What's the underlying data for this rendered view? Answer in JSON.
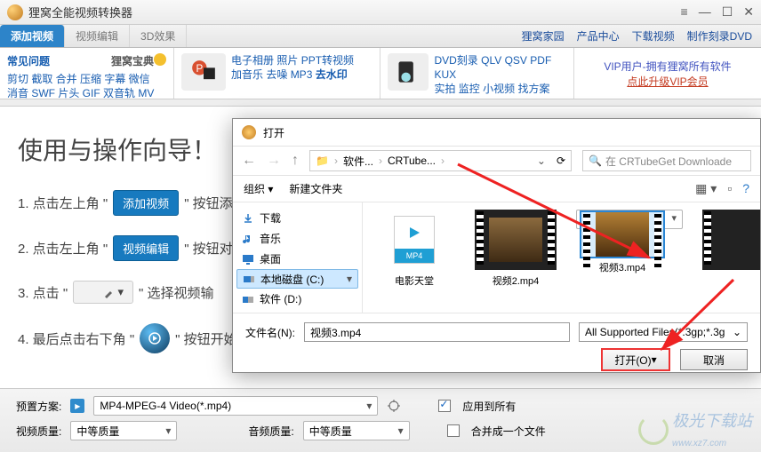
{
  "window": {
    "title": "狸窝全能视频转换器"
  },
  "tabs": {
    "add": "添加视频",
    "edit": "视频编辑",
    "fx": "3D效果"
  },
  "topLinks": {
    "l1": "狸窝家园",
    "l2": "产品中心",
    "l3": "下载视频",
    "l4": "制作刻录DVD"
  },
  "cell1": {
    "hd": "常见问题",
    "baodian": "狸窝宝典",
    "l1": "剪切 截取 合并 压缩 字幕 微信",
    "l2": "消音 SWF 片头 GIF 双音轨 MV"
  },
  "cell2": {
    "l1a": "电子相册 ",
    "l1b": "照片 ",
    "l1c": "PPT转视频",
    "l2a": "加音乐 ",
    "l2b": "去噪 ",
    "l2c": "MP3 ",
    "l2d": "去水印"
  },
  "cell3": {
    "l1": "DVD刻录 QLV QSV PDF KUX",
    "l2": "实拍 监控 小视频 找方案"
  },
  "cell4": {
    "l1": "VIP用户-拥有狸窝所有软件",
    "l2": "点此升级VIP会员"
  },
  "wizard": {
    "title": "使用与操作向导！",
    "s1a": "1. 点击左上角 \"",
    "s1btn": "添加视频",
    "s1b": "\" 按钮添加",
    "s2a": "2. 点击左上角 \"",
    "s2btn": "视频编辑",
    "s2b": "\" 按钮对视",
    "s3a": "3. 点击 \"",
    "s3b": "\" 选择视频输",
    "s4a": "4. 最后点击右下角 \"",
    "s4b": "\" 按钮开始"
  },
  "bottom": {
    "preset_lbl": "预置方案:",
    "preset_val": "MP4-MPEG-4 Video(*.mp4)",
    "apply_all": "应用到所有",
    "vq_lbl": "视频质量:",
    "vq_val": "中等质量",
    "aq_lbl": "音频质量:",
    "aq_val": "中等质量",
    "merge": "合并成一个文件",
    "wm": "极光下载站",
    "wm_url": "www.xz7.com"
  },
  "dlg": {
    "title": "打开",
    "crumb1": "软件...",
    "crumb2": "CRTube...",
    "search_ph": "在 CRTubeGet Downloade",
    "org": "组织",
    "newf": "新建文件夹",
    "tree": {
      "dl": "下载",
      "music": "音乐",
      "desktop": "桌面",
      "cdrive": "本地磁盘 (C:)",
      "ddrive": "软件 (D:)"
    },
    "files": {
      "f1": "电影天堂",
      "f2": "视频2.mp4",
      "f3": "视频3.mp4",
      "mp4": "MP4"
    },
    "fn_lbl": "文件名(N):",
    "fn_val": "视频3.mp4",
    "filter": "All Supported Files(*.3gp;*.3g",
    "open": "打开(O)",
    "cancel": "取消"
  }
}
